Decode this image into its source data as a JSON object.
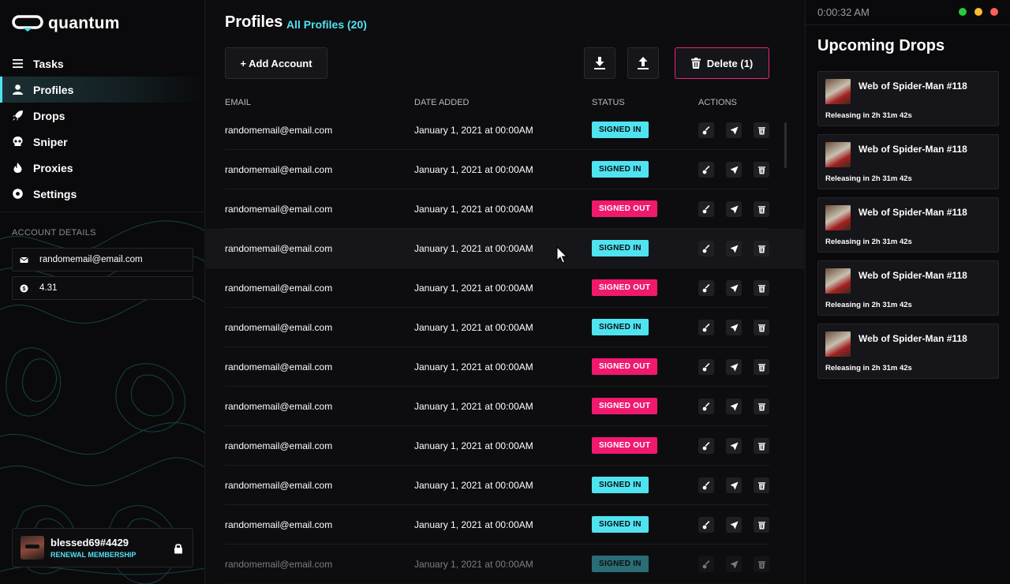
{
  "app": {
    "name": "quantum"
  },
  "nav": [
    {
      "label": "Tasks",
      "icon": "list-icon"
    },
    {
      "label": "Profiles",
      "icon": "user-icon",
      "active": true
    },
    {
      "label": "Drops",
      "icon": "rocket-icon"
    },
    {
      "label": "Sniper",
      "icon": "skull-icon"
    },
    {
      "label": "Proxies",
      "icon": "flame-icon"
    },
    {
      "label": "Settings",
      "icon": "gear-icon"
    }
  ],
  "account": {
    "title": "ACCOUNT DETAILS",
    "email": "randomemail@email.com",
    "balance": "4.31"
  },
  "user": {
    "name": "blessed69#4429",
    "membership": "RENEWAL MEMBERSHIP"
  },
  "main": {
    "title": "Profiles",
    "subtitle": "All Profiles (20)",
    "add_label": "+ Add Account",
    "delete_label": "Delete (1)",
    "columns": [
      "EMAIL",
      "DATE ADDED",
      "STATUS",
      "ACTIONS"
    ],
    "rows": [
      {
        "email": "randomemail@email.com",
        "date": "January 1, 2021 at 00:00AM",
        "status": "SIGNED IN"
      },
      {
        "email": "randomemail@email.com",
        "date": "January 1, 2021 at 00:00AM",
        "status": "SIGNED IN"
      },
      {
        "email": "randomemail@email.com",
        "date": "January 1, 2021 at 00:00AM",
        "status": "SIGNED OUT"
      },
      {
        "email": "randomemail@email.com",
        "date": "January 1, 2021 at 00:00AM",
        "status": "SIGNED IN"
      },
      {
        "email": "randomemail@email.com",
        "date": "January 1, 2021 at 00:00AM",
        "status": "SIGNED OUT"
      },
      {
        "email": "randomemail@email.com",
        "date": "January 1, 2021 at 00:00AM",
        "status": "SIGNED IN"
      },
      {
        "email": "randomemail@email.com",
        "date": "January 1, 2021 at 00:00AM",
        "status": "SIGNED OUT"
      },
      {
        "email": "randomemail@email.com",
        "date": "January 1, 2021 at 00:00AM",
        "status": "SIGNED OUT"
      },
      {
        "email": "randomemail@email.com",
        "date": "January 1, 2021 at 00:00AM",
        "status": "SIGNED OUT"
      },
      {
        "email": "randomemail@email.com",
        "date": "January 1, 2021 at 00:00AM",
        "status": "SIGNED IN"
      },
      {
        "email": "randomemail@email.com",
        "date": "January 1, 2021 at 00:00AM",
        "status": "SIGNED IN"
      },
      {
        "email": "randomemail@email.com",
        "date": "January 1, 2021 at 00:00AM",
        "status": "SIGNED IN"
      }
    ]
  },
  "right": {
    "clock": "0:00:32 AM",
    "title": "Upcoming Drops",
    "drops": [
      {
        "name": "Web of Spider-Man #118",
        "release": "Releasing in 2h 31m 42s"
      },
      {
        "name": "Web of Spider-Man #118",
        "release": "Releasing in 2h 31m 42s"
      },
      {
        "name": "Web of Spider-Man #118",
        "release": "Releasing in 2h 31m 42s"
      },
      {
        "name": "Web of Spider-Man #118",
        "release": "Releasing in 2h 31m 42s"
      },
      {
        "name": "Web of Spider-Man #118",
        "release": "Releasing in 2h 31m 42s"
      }
    ]
  },
  "colors": {
    "accent": "#4fe3f0",
    "danger": "#f0196e",
    "bg": "#0d0d10"
  }
}
